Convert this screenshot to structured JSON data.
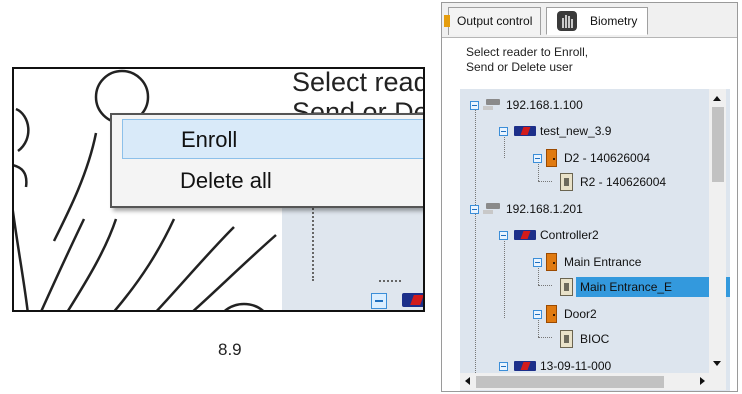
{
  "zoom": {
    "side_text_line1": "Select read",
    "side_text_line2": "Send or De",
    "menu": [
      {
        "label": "Enroll",
        "highlighted": true
      },
      {
        "label": "Delete all",
        "highlighted": false
      }
    ]
  },
  "caption": "8.9",
  "window": {
    "tabs": [
      {
        "label": "Output control",
        "icon": "door-output-icon"
      },
      {
        "label": "Biometry",
        "icon": "biometry-hand-icon",
        "active": true
      }
    ],
    "instructions_line1": "Select reader to Enroll,",
    "instructions_line2": "Send or Delete user",
    "tree": [
      {
        "label": "192.168.1.100",
        "type": "network"
      },
      {
        "label": "test_new_3.9",
        "type": "controller"
      },
      {
        "label": "D2 - 140626004",
        "type": "door"
      },
      {
        "label": "R2 - 140626004",
        "type": "reader"
      },
      {
        "label": "192.168.1.201",
        "type": "network"
      },
      {
        "label": "Controller2",
        "type": "controller"
      },
      {
        "label": "Main Entrance",
        "type": "door"
      },
      {
        "label": "Main Entrance_E",
        "type": "reader",
        "selected": true
      },
      {
        "label": "Door2",
        "type": "door"
      },
      {
        "label": "BIOC",
        "type": "reader"
      },
      {
        "label": "13-09-11-000",
        "type": "controller"
      }
    ]
  },
  "colors": {
    "selection": "#3399dd",
    "menu_highlight": "#d9eaf9",
    "tree_background": "#dde5ee",
    "controller_blue": "#1c2f8a",
    "door_orange": "#e07a10"
  }
}
